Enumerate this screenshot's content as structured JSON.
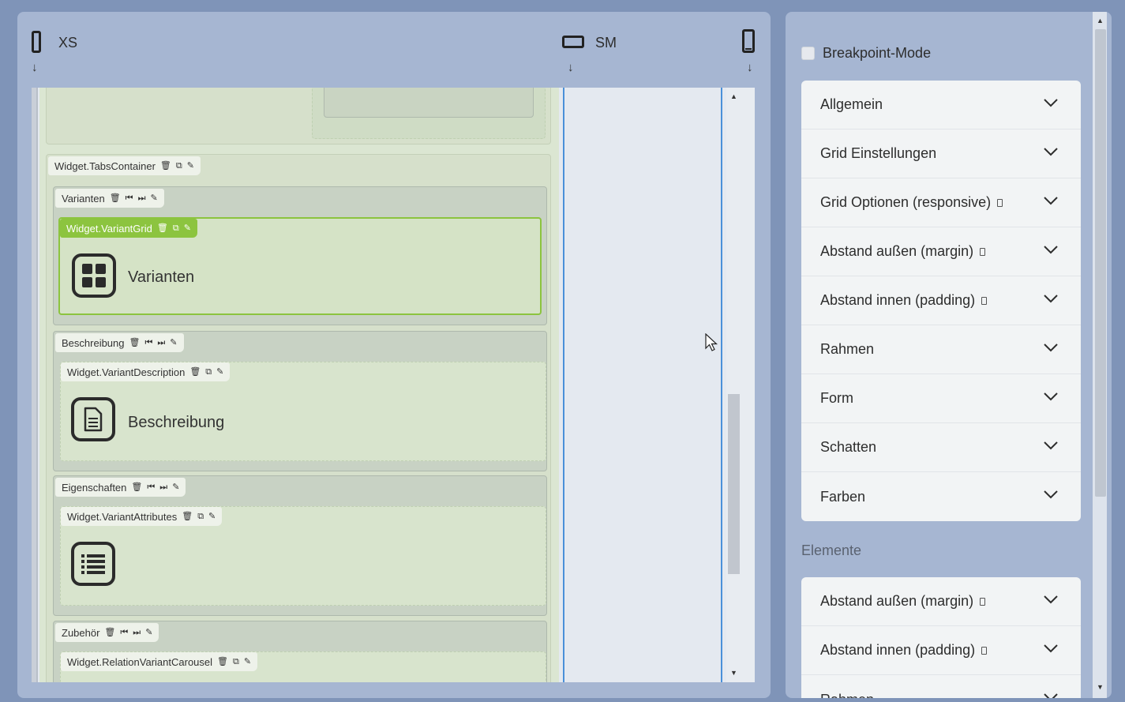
{
  "breakpoints": {
    "xs": {
      "label": "XS",
      "arrow": "↓",
      "icon": "phone-portrait-icon"
    },
    "sm": {
      "label": "SM",
      "arrow": "↓",
      "icon": "phone-landscape-icon"
    },
    "md": {
      "arrow": "↓",
      "icon": "tablet-icon"
    }
  },
  "tabs_container": {
    "label": "Widget.TabsContainer"
  },
  "tabs": [
    {
      "label": "Varianten",
      "widget": "Widget.VariantGrid",
      "widget_text": "Varianten",
      "icon": "grid-icon"
    },
    {
      "label": "Beschreibung",
      "widget": "Widget.VariantDescription",
      "widget_text": "Beschreibung",
      "icon": "document-icon"
    },
    {
      "label": "Eigenschaften",
      "widget": "Widget.VariantAttributes",
      "widget_text": "",
      "icon": "list-icon"
    },
    {
      "label": "Zubehör",
      "widget": "Widget.RelationVariantCarousel",
      "widget_text": "",
      "icon": "carousel-icon"
    }
  ],
  "settings": {
    "breakpoint_mode": "Breakpoint-Mode",
    "section_items": [
      "Allgemein",
      "Grid Einstellungen",
      "Grid Optionen (responsive)",
      "Abstand außen (margin)",
      "Abstand innen (padding)",
      "Rahmen",
      "Form",
      "Schatten",
      "Farben"
    ],
    "elements_label": "Elemente",
    "element_items": [
      "Abstand außen (margin)",
      "Abstand innen (padding)",
      "Rahmen"
    ]
  },
  "colors": {
    "accent": "#8cc43f",
    "guide_line": "#4a90d9",
    "panel": "#a6b6d2"
  }
}
